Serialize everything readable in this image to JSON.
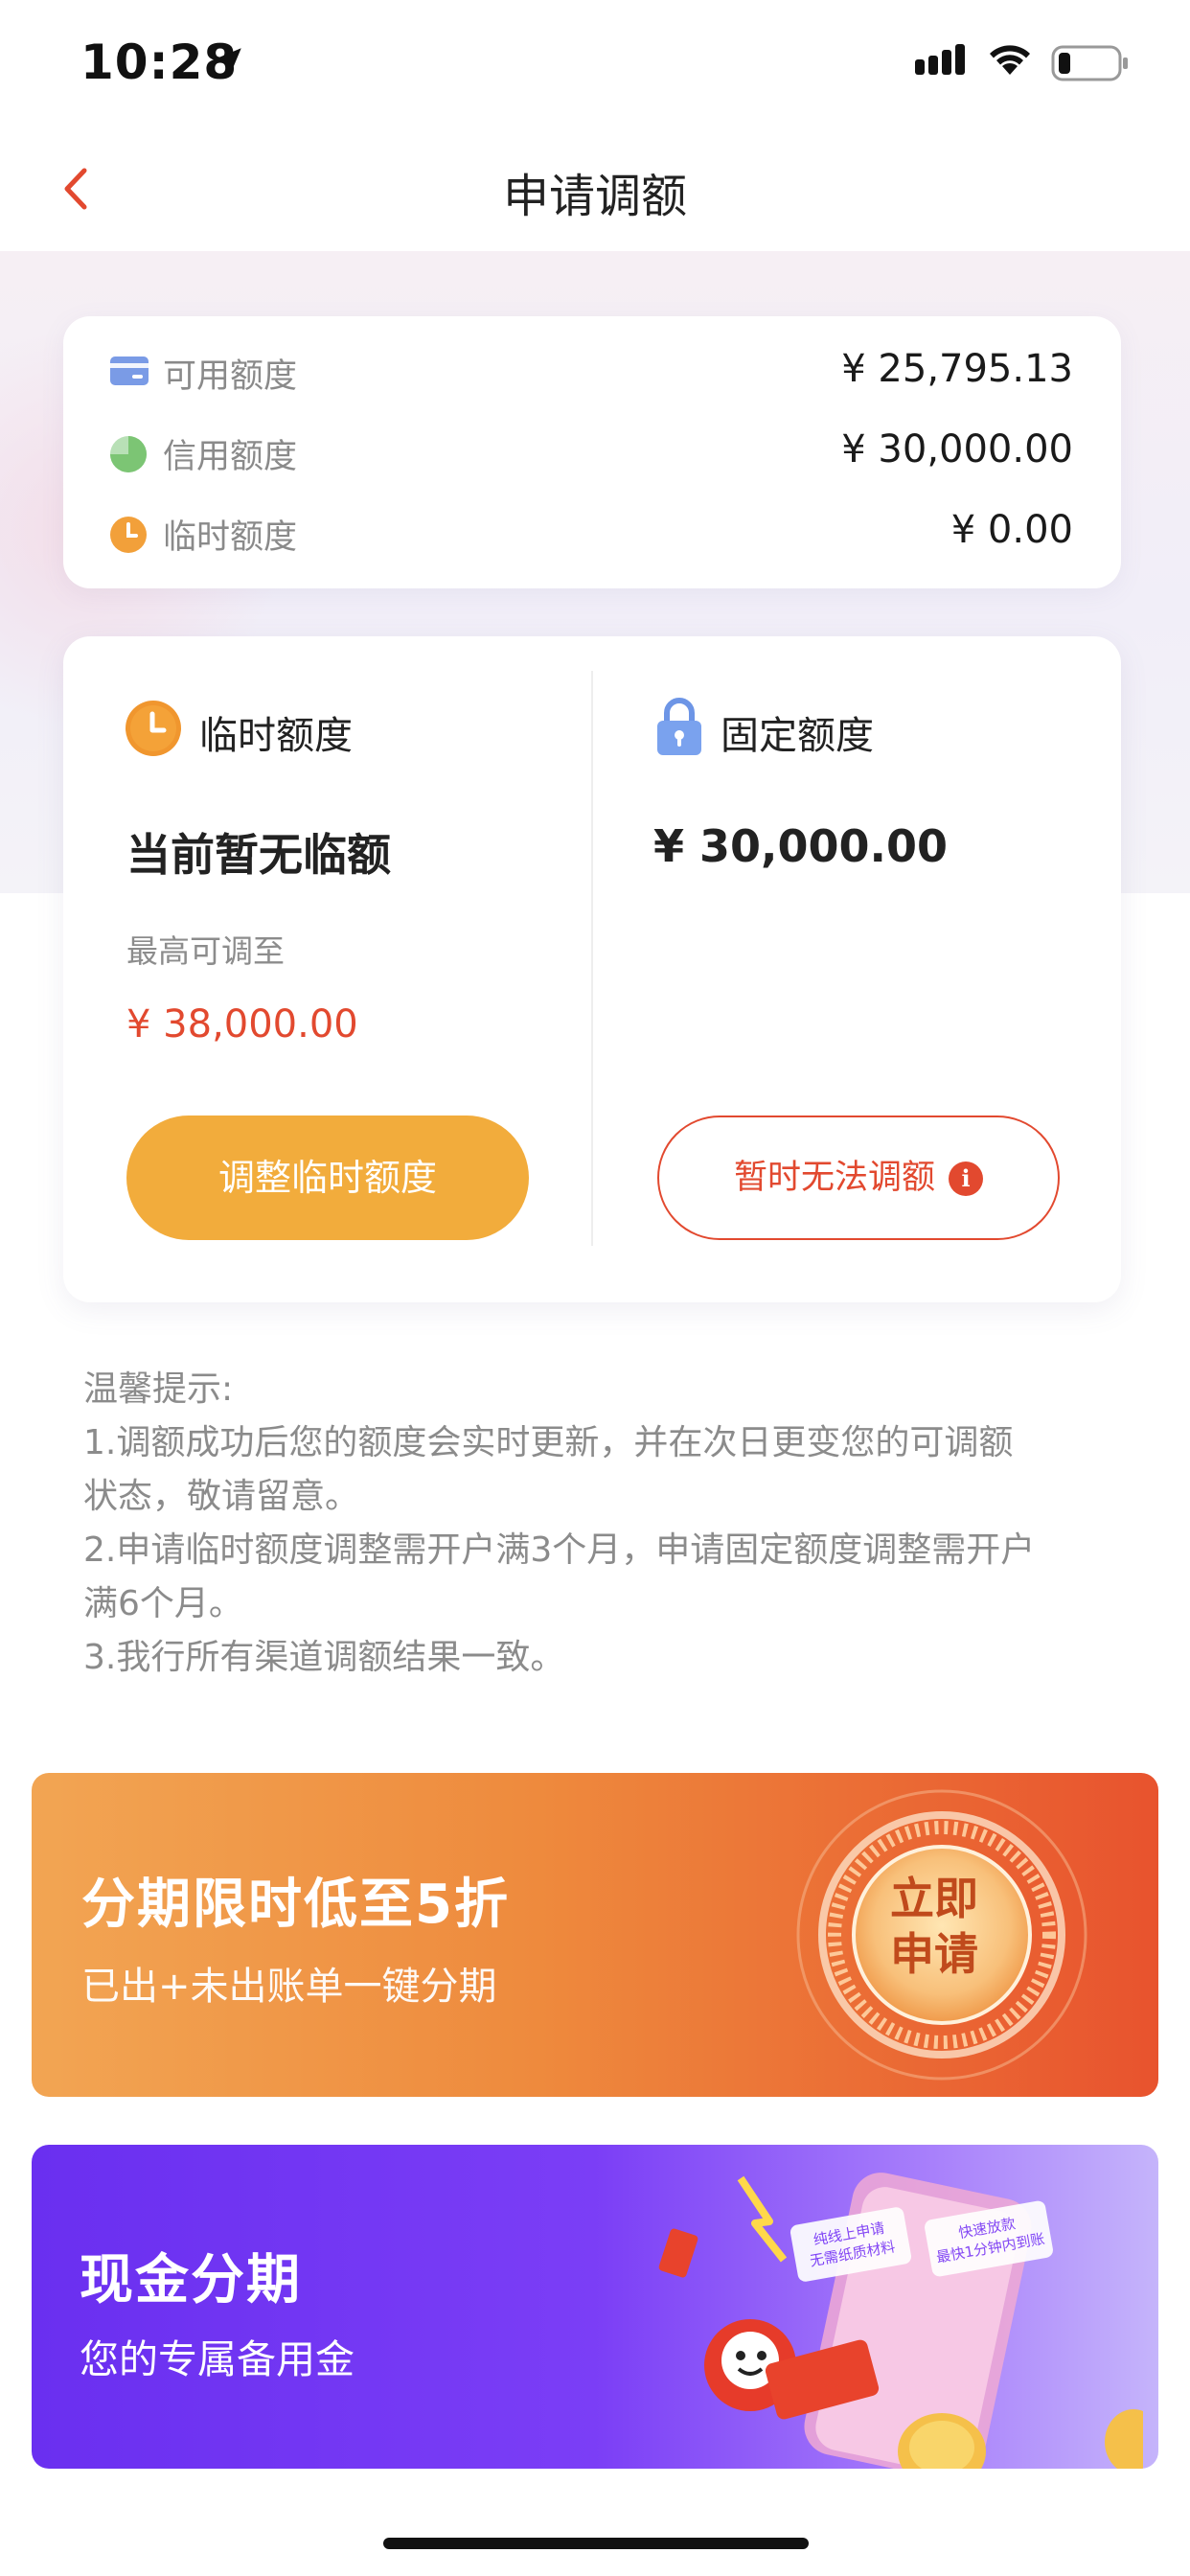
{
  "status_bar": {
    "time": "10:28"
  },
  "nav": {
    "title": "申请调额"
  },
  "summary": {
    "rows": [
      {
        "label": "可用额度",
        "value": "¥ 25,795.13",
        "icon": "card-icon"
      },
      {
        "label": "信用额度",
        "value": "¥ 30,000.00",
        "icon": "pie-icon"
      },
      {
        "label": "临时额度",
        "value": "¥ 0.00",
        "icon": "clock-icon"
      }
    ]
  },
  "temp_quota": {
    "title": "临时额度",
    "status": "当前暂无临额",
    "max_label": "最高可调至",
    "max_value": "¥ 38,000.00",
    "button": "调整临时额度"
  },
  "fixed_quota": {
    "title": "固定额度",
    "amount": "¥ 30,000.00",
    "button": "暂时无法调额",
    "info_glyph": "i"
  },
  "tips": {
    "lines": [
      "温馨提示:",
      "1.调额成功后您的额度会实时更新，并在次日更变您的可调额",
      "状态，敬请留意。",
      "2.申请临时额度调整需开户满3个月，申请固定额度调整需开户",
      "满6个月。",
      "3.我行所有渠道调额结果一致。"
    ]
  },
  "banner_installment": {
    "title": "分期限时低至5折",
    "subtitle": "已出+未出账单一键分期",
    "badge_line1": "立即",
    "badge_line2": "申请"
  },
  "banner_cash": {
    "title": "现金分期",
    "subtitle": "您的专属备用金",
    "phone_tag1_line1": "纯线上申请",
    "phone_tag1_line2": "无需纸质材料",
    "phone_tag2_line1": "快速放款",
    "phone_tag2_line2": "最快1分钟内到账"
  },
  "colors": {
    "accent_red": "#e2492f",
    "accent_orange": "#f2ac3c",
    "purple": "#7b3ef6"
  }
}
